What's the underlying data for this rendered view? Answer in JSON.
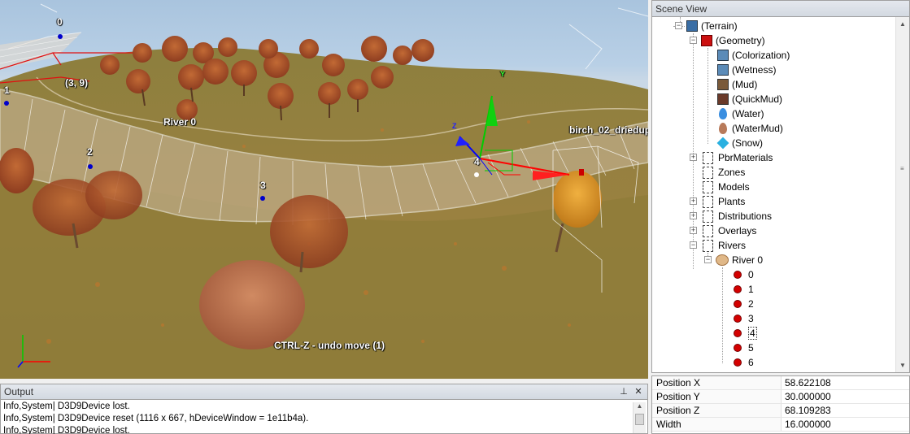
{
  "viewport": {
    "labels": {
      "point_0": "0",
      "point_1": "1",
      "point_2": "2",
      "point_3": "3",
      "point_4": "4",
      "coord": "(3, 9)",
      "river": "River 0",
      "birch": "birch_02_driedup",
      "undo_hint": "CTRL-Z - undo move (1)"
    },
    "gizmo": {
      "y_axis": "Y",
      "z_axis": "Z"
    },
    "colors": {
      "grass": "#8b7d3c",
      "tree": "#b5562c",
      "river_band": "#c9b79a",
      "gizmo_x": "#ff0000",
      "gizmo_y": "#00cc00",
      "gizmo_z": "#0000ff"
    }
  },
  "output": {
    "title": "Output",
    "pin_icon": "pin-icon",
    "close_icon": "close-icon",
    "lines": [
      "Info,System| D3D9Device lost.",
      "Info,System| D3D9Device reset (1116 x 667, hDeviceWindow = 1e11b4a).",
      "Info,System| D3D9Device lost."
    ]
  },
  "scene": {
    "title": "Scene View",
    "tree": {
      "terrain": "(Terrain)",
      "geometry": "(Geometry)",
      "colorization": "(Colorization)",
      "wetness": "(Wetness)",
      "mud": "(Mud)",
      "quickmud": "(QuickMud)",
      "water": "(Water)",
      "watermud": "(WaterMud)",
      "snow": "(Snow)",
      "pbr": "PbrMaterials",
      "zones": "Zones",
      "models": "Models",
      "plants": "Plants",
      "distributions": "Distributions",
      "overlays": "Overlays",
      "rivers": "Rivers",
      "river0": "River 0",
      "points": [
        "0",
        "1",
        "2",
        "3",
        "4",
        "5",
        "6"
      ]
    }
  },
  "properties": [
    {
      "key": "Position X",
      "value": "58.622108"
    },
    {
      "key": "Position Y",
      "value": "30.000000"
    },
    {
      "key": "Position Z",
      "value": "68.109283"
    },
    {
      "key": "Width",
      "value": "16.000000"
    }
  ]
}
